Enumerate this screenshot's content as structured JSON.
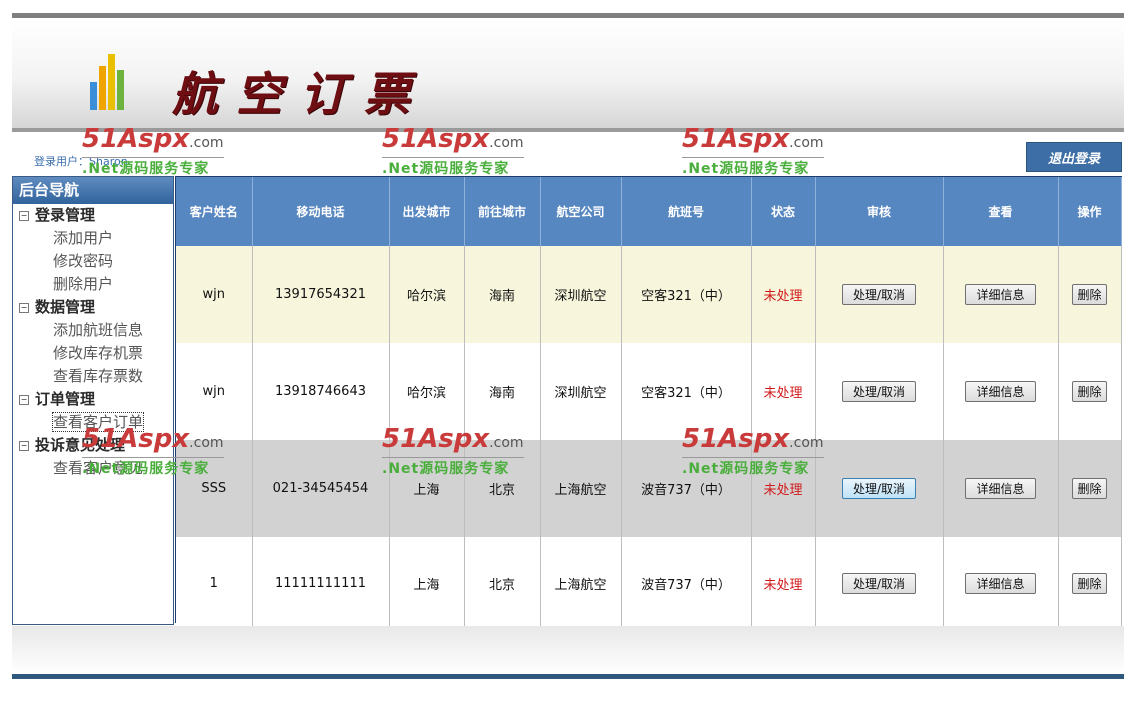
{
  "header": {
    "title": "航空订票"
  },
  "user": {
    "label": "登录用户：",
    "name": "Sharon"
  },
  "logout_label": "退出登录",
  "sidebar": {
    "title": "后台导航",
    "groups": [
      {
        "label": "登录管理",
        "items": [
          "添加用户",
          "修改密码",
          "删除用户"
        ]
      },
      {
        "label": "数据管理",
        "items": [
          "添加航班信息",
          "修改库存机票",
          "查看库存票数"
        ]
      },
      {
        "label": "订单管理",
        "items": [
          "查看客户订单"
        ]
      },
      {
        "label": "投诉意见处理",
        "items": [
          "查看客户意见"
        ]
      }
    ]
  },
  "table": {
    "headers": [
      "客户姓名",
      "移动电话",
      "出发城市",
      "前往城市",
      "航空公司",
      "航班号",
      "状态",
      "审核",
      "查看",
      "操作"
    ],
    "rows": [
      [
        "wjn",
        "13917654321",
        "哈尔滨",
        "海南",
        "深圳航空",
        "空客321（中）",
        "未处理"
      ],
      [
        "wjn",
        "13918746643",
        "哈尔滨",
        "海南",
        "深圳航空",
        "空客321（中）",
        "未处理"
      ],
      [
        "SSS",
        "021-34545454",
        "上海",
        "北京",
        "上海航空",
        "波音737（中）",
        "未处理"
      ],
      [
        "1",
        "11111111111",
        "上海",
        "北京",
        "上海航空",
        "波音737（中）",
        "未处理"
      ]
    ],
    "buttons": {
      "review": "处理/取消",
      "details": "详细信息",
      "delete": "删除"
    }
  },
  "watermark": {
    "brand": "51Aspx",
    "domain": ".com",
    "tagline": ".Net源码服务专家"
  },
  "colors": {
    "title": "#6e0e12",
    "header_row": "#5787c0",
    "status": "#d11a1a",
    "sidebar_head": "#31639c"
  }
}
